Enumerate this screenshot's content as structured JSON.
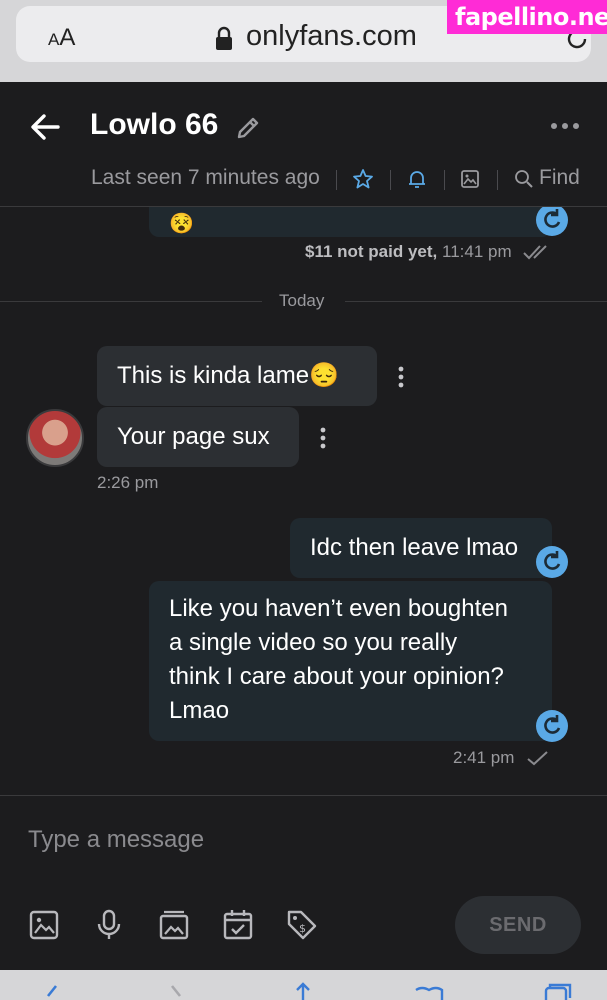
{
  "browser": {
    "aa_small": "A",
    "aa_large": "A",
    "url": "onlyfans.com",
    "watermark": "fapellino.net"
  },
  "header": {
    "name": "Lowlo 66",
    "last_seen": "Last seen 7 minutes ago",
    "find_label": "Find"
  },
  "messages": {
    "earlier_meta_status": "$11 not paid yet,",
    "earlier_meta_time": "11:41 pm",
    "divider_label": "Today",
    "incoming": [
      {
        "text": "This is kinda lame😔"
      },
      {
        "text": "Your page sux"
      }
    ],
    "incoming_time": "2:26 pm",
    "outgoing": [
      {
        "text": "Idc then leave lmao"
      },
      {
        "text": "Like you haven’t even boughten\na single video so you really\nthink I care about your opinion?\nLmao"
      }
    ],
    "outgoing_time": "2:41 pm"
  },
  "composer": {
    "placeholder": "Type a message",
    "send_label": "SEND"
  },
  "colors": {
    "accent": "#5aa9e6",
    "background": "#1c1c1e",
    "bubble_in": "#2c2f33",
    "bubble_out": "#20292f",
    "watermark": "#ff2bd6"
  }
}
